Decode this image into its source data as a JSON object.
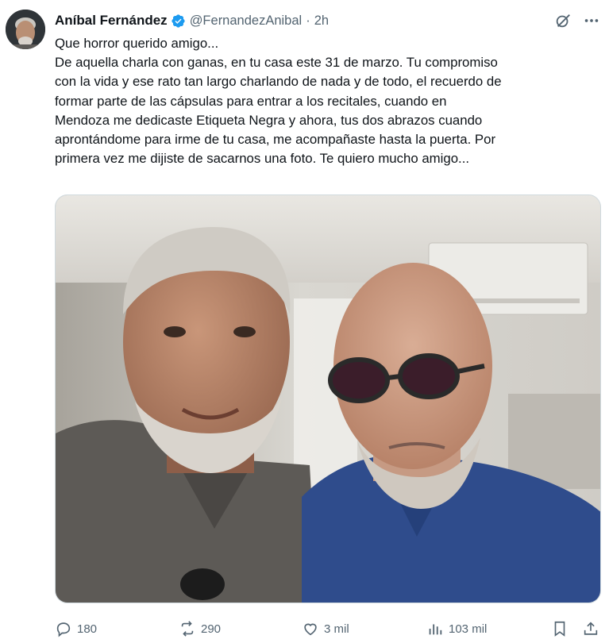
{
  "tweet": {
    "author_name": "Aníbal Fernández",
    "handle": "@FernandezAnibal",
    "separator": "·",
    "time": "2h",
    "text_lines": [
      "Que horror querido amigo...",
      "De aquella charla con ganas, en tu casa este 31 de marzo. Tu compromiso",
      "con la vida y ese rato tan largo charlando de nada y de todo, el recuerdo de",
      "formar parte de las cápsulas para entrar a los recitales, cuando en",
      "Mendoza me dedicaste Etiqueta Negra y ahora, tus dos abrazos cuando",
      "aprontándome para irme de tu casa, me acompañaste hasta la puerta. Por",
      "primera vez me dijiste de sacarnos una foto. Te quiero mucho amigo..."
    ]
  },
  "actions": {
    "replies": "180",
    "reposts": "290",
    "likes": "3 mil",
    "views": "103 mil"
  },
  "icons": {
    "verified": "verified-badge-icon",
    "grok": "grok-icon",
    "more": "more-icon",
    "reply": "reply-icon",
    "repost": "repost-icon",
    "like": "heart-icon",
    "views": "views-icon",
    "bookmark": "bookmark-icon",
    "share": "share-icon"
  },
  "colors": {
    "verified": "#1d9bf0",
    "muted": "#536471",
    "text": "#0f1419"
  }
}
